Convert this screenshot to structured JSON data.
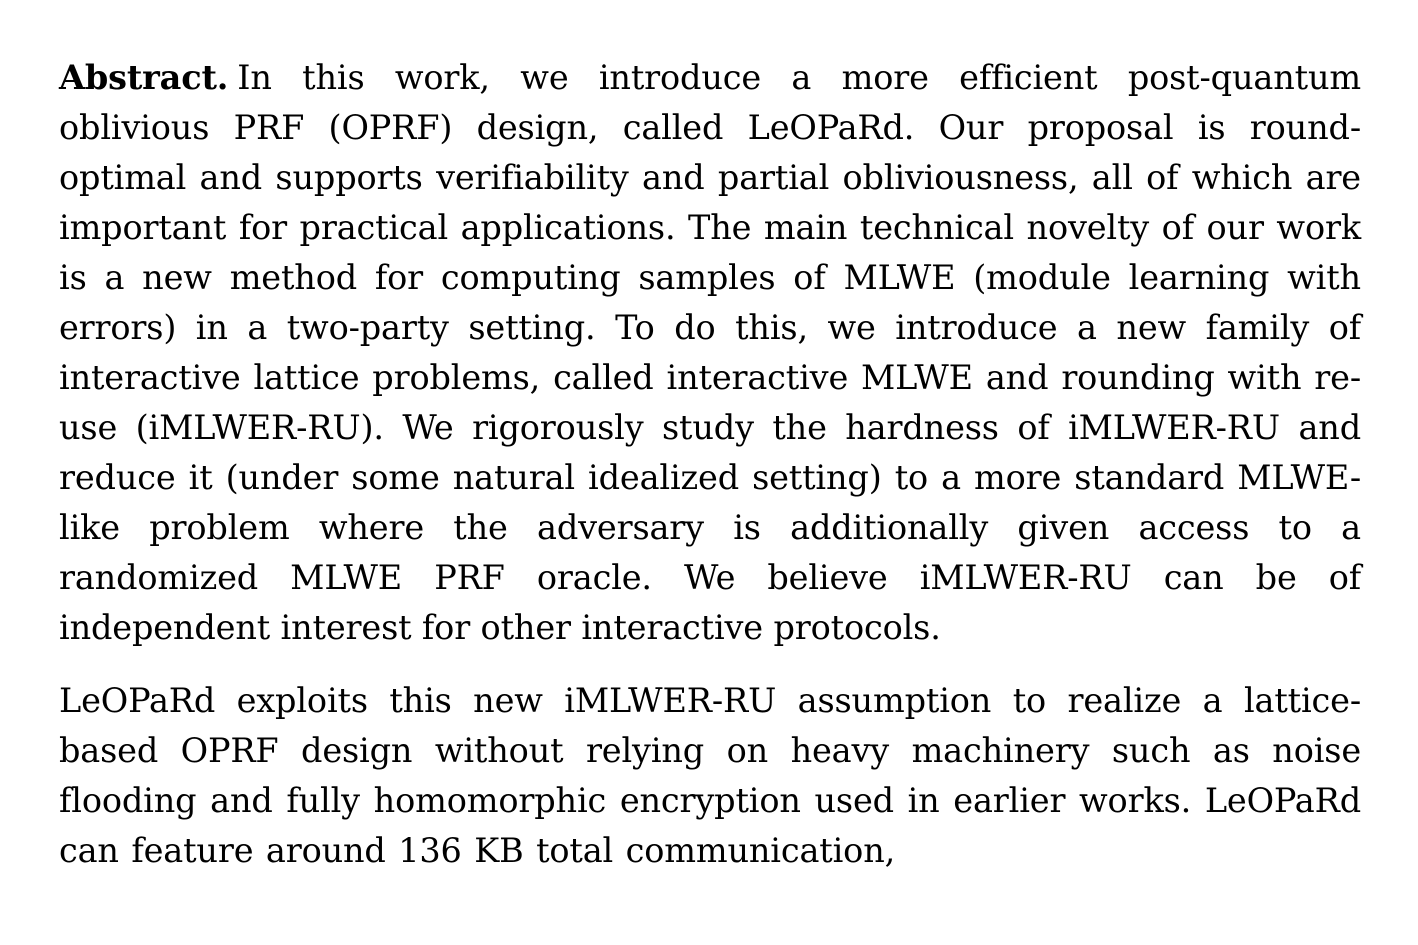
{
  "document": {
    "type": "paper-abstract",
    "background_color": "#ffffff",
    "text_color": "#000000",
    "paragraphs": [
      {
        "id": "abstract-paragraph",
        "label": "Abstract.",
        "text_after_label": "In this work, we introduce a more efficient post-quantum oblivious PRF (OPRF) design, called LeOPaRd. Our proposal is round-optimal and supports verifiability and partial obliviousness, all of which are important for practical applications.  The main technical novelty of our work is a new method for computing samples of MLWE (module learning with errors) in a two-party setting.  To do this, we introduce a new family of interactive lattice problems, called interactive MLWE and rounding with re-use (iMLWER-RU). We rigorously study the hardness of iMLWER-RU and reduce it (under some natural idealized setting) to a more standard MLWE-like problem where the adversary is additionally given access to a randomized MLWE PRF oracle.  We believe iMLWER-RU can be of independent interest for other interactive protocols."
      },
      {
        "id": "second-paragraph",
        "text": "LeOPaRd exploits this new iMLWER-RU assumption to realize a lattice-based OPRF design without relying on heavy machinery such as noise flooding and fully homomorphic encryption used in earlier works.  LeOPaRd can feature around 136 KB total communication,"
      }
    ],
    "lines": [
      "Abstract.  In this work, we introduce a more efficient post-quantum",
      "oblivious PRF (OPRF) design, called LeOPaRd. Our proposal is round-",
      "optimal and supports verifiability and partial obliviousness, all of which",
      "are important for practical applications.  The main technical novelty of",
      "our work is a new method for computing samples of MLWE (module",
      "learning with errors) in a two-party setting.  To do this, we introduce a",
      "new family of interactive lattice problems, called interactive MLWE and",
      "rounding with re-use (iMLWER-RU). We rigorously study the hardness",
      "of iMLWER-RU and reduce it (under some natural idealized setting) to a",
      "more standard MLWE-like problem where the adversary is additionally",
      "given access to a randomized MLWE PRF oracle.  We believe iMLWER-",
      "RU can be of independent interest for other interactive protocols.",
      "LeOPaRd exploits this new iMLWER-RU assumption to realize a",
      "lattice-based OPRF design without relying on heavy machinery such",
      "as noise flooding and fully homomorphic encryption used in earlier",
      "works.  LeOPaRd can feature around 136 KB total communication,"
    ]
  }
}
